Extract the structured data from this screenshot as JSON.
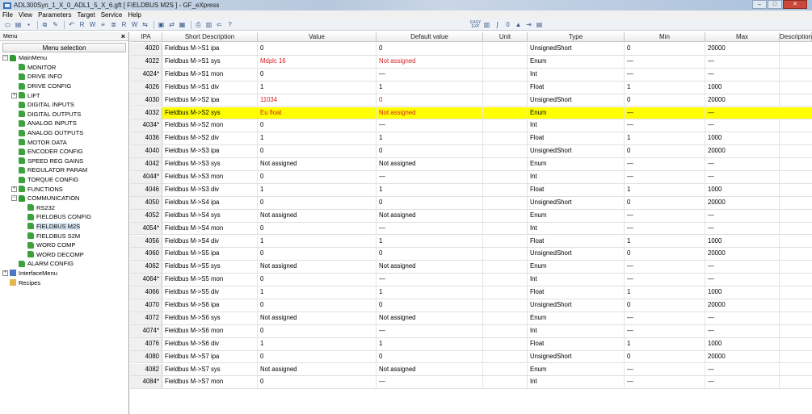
{
  "window": {
    "title": "ADL300Syn_1_X_0_ADL1_5_X_6.gft [ FIELDBUS M2S ] - GF_eXpress",
    "controls": [
      "–",
      "□",
      "✕"
    ]
  },
  "menubar": [
    "File",
    "View",
    "Parameters",
    "Target",
    "Service",
    "Help"
  ],
  "toolbar": {
    "group1": [
      "new-icon",
      "open-icon",
      "save-icon",
      "copy-icon",
      "edit-icon",
      "undo-icon",
      "r-icon",
      "w-icon",
      "w2-icon",
      "w3-icon",
      "r2-icon",
      "w4-icon",
      "compare-icon",
      "monitor-icon",
      "online-icon",
      "module-icon",
      "print-icon",
      "report-icon",
      "back-icon",
      "help-icon"
    ],
    "group2": [
      "easy-exp-icon",
      "bar-icon",
      "curve-icon",
      "zero-icon",
      "warning-icon",
      "expand-icon",
      "panel-icon"
    ],
    "group2_first_label": "EASY EXP"
  },
  "left_panel": {
    "title": "Menu",
    "close": "×",
    "menu_selection": "Menu selection",
    "tree": [
      {
        "label": "MainMenu",
        "level": 0,
        "exp": "−",
        "icon": "folder-open"
      },
      {
        "label": "MONITOR",
        "level": 1,
        "exp": "",
        "icon": "folder"
      },
      {
        "label": "DRIVE INFO",
        "level": 1,
        "exp": "",
        "icon": "folder"
      },
      {
        "label": "DRIVE CONFIG",
        "level": 1,
        "exp": "",
        "icon": "folder"
      },
      {
        "label": "LIFT",
        "level": 1,
        "exp": "+",
        "icon": "folder"
      },
      {
        "label": "DIGITAL INPUTS",
        "level": 1,
        "exp": "",
        "icon": "folder"
      },
      {
        "label": "DIGITAL OUTPUTS",
        "level": 1,
        "exp": "",
        "icon": "folder"
      },
      {
        "label": "ANALOG INPUTS",
        "level": 1,
        "exp": "",
        "icon": "folder"
      },
      {
        "label": "ANALOG OUTPUTS",
        "level": 1,
        "exp": "",
        "icon": "folder"
      },
      {
        "label": "MOTOR DATA",
        "level": 1,
        "exp": "",
        "icon": "folder"
      },
      {
        "label": "ENCODER CONFIG",
        "level": 1,
        "exp": "",
        "icon": "folder"
      },
      {
        "label": "SPEED REG GAINS",
        "level": 1,
        "exp": "",
        "icon": "folder"
      },
      {
        "label": "REGULATOR PARAM",
        "level": 1,
        "exp": "",
        "icon": "folder"
      },
      {
        "label": "TORQUE CONFIG",
        "level": 1,
        "exp": "",
        "icon": "folder"
      },
      {
        "label": "FUNCTIONS",
        "level": 1,
        "exp": "+",
        "icon": "folder"
      },
      {
        "label": "COMMUNICATION",
        "level": 1,
        "exp": "−",
        "icon": "folder-open"
      },
      {
        "label": "RS232",
        "level": 2,
        "exp": "",
        "icon": "folder"
      },
      {
        "label": "FIELDBUS CONFIG",
        "level": 2,
        "exp": "",
        "icon": "folder"
      },
      {
        "label": "FIELDBUS M2S",
        "level": 2,
        "exp": "",
        "icon": "folder",
        "selected": true
      },
      {
        "label": "FIELDBUS S2M",
        "level": 2,
        "exp": "",
        "icon": "folder"
      },
      {
        "label": "WORD COMP",
        "level": 2,
        "exp": "",
        "icon": "folder"
      },
      {
        "label": "WORD DECOMP",
        "level": 2,
        "exp": "",
        "icon": "folder"
      },
      {
        "label": "ALARM CONFIG",
        "level": 1,
        "exp": "",
        "icon": "folder"
      },
      {
        "label": "InterfaceMenu",
        "level": 0,
        "exp": "+",
        "icon": "iface"
      },
      {
        "label": "Recipes",
        "level": 0,
        "exp": "",
        "icon": "recipes"
      }
    ]
  },
  "grid": {
    "columns": [
      "IPA",
      "Short Description",
      "Value",
      "Default value",
      "Unit",
      "Type",
      "Min",
      "Max",
      "Description"
    ],
    "rows": [
      {
        "ipa": "4020",
        "desc": "Fieldbus M->S1 ipa",
        "value": "0",
        "default": "0",
        "unit": "",
        "type": "UnsignedShort",
        "min": "0",
        "max": "20000"
      },
      {
        "ipa": "4022",
        "desc": "Fieldbus M->S1 sys",
        "value": "Mdplc 16",
        "default": "Not assigned",
        "unit": "",
        "type": "Enum",
        "min": "—",
        "max": "—",
        "red": true
      },
      {
        "ipa": "4024*",
        "desc": "Fieldbus M->S1 mon",
        "value": "0",
        "default": "—",
        "unit": "",
        "type": "Int",
        "min": "—",
        "max": "—"
      },
      {
        "ipa": "4026",
        "desc": "Fieldbus M->S1 div",
        "value": "1",
        "default": "1",
        "unit": "",
        "type": "Float",
        "min": "1",
        "max": "1000"
      },
      {
        "ipa": "4030",
        "desc": "Fieldbus M->S2 ipa",
        "value": "11034",
        "default": "0",
        "unit": "",
        "type": "UnsignedShort",
        "min": "0",
        "max": "20000",
        "red": true
      },
      {
        "ipa": "4032",
        "desc": "Fieldbus M->S2 sys",
        "value": "Eu float",
        "default": "Not assigned",
        "unit": "",
        "type": "Enum",
        "min": "—",
        "max": "—",
        "red": true,
        "highlight": true
      },
      {
        "ipa": "4034*",
        "desc": "Fieldbus M->S2 mon",
        "value": "0",
        "default": "—",
        "unit": "",
        "type": "Int",
        "min": "—",
        "max": "—"
      },
      {
        "ipa": "4036",
        "desc": "Fieldbus M->S2 div",
        "value": "1",
        "default": "1",
        "unit": "",
        "type": "Float",
        "min": "1",
        "max": "1000"
      },
      {
        "ipa": "4040",
        "desc": "Fieldbus M->S3 ipa",
        "value": "0",
        "default": "0",
        "unit": "",
        "type": "UnsignedShort",
        "min": "0",
        "max": "20000"
      },
      {
        "ipa": "4042",
        "desc": "Fieldbus M->S3 sys",
        "value": "Not assigned",
        "default": "Not assigned",
        "unit": "",
        "type": "Enum",
        "min": "—",
        "max": "—"
      },
      {
        "ipa": "4044*",
        "desc": "Fieldbus M->S3 mon",
        "value": "0",
        "default": "—",
        "unit": "",
        "type": "Int",
        "min": "—",
        "max": "—"
      },
      {
        "ipa": "4046",
        "desc": "Fieldbus M->S3 div",
        "value": "1",
        "default": "1",
        "unit": "",
        "type": "Float",
        "min": "1",
        "max": "1000"
      },
      {
        "ipa": "4050",
        "desc": "Fieldbus M->S4 ipa",
        "value": "0",
        "default": "0",
        "unit": "",
        "type": "UnsignedShort",
        "min": "0",
        "max": "20000"
      },
      {
        "ipa": "4052",
        "desc": "Fieldbus M->S4 sys",
        "value": "Not assigned",
        "default": "Not assigned",
        "unit": "",
        "type": "Enum",
        "min": "—",
        "max": "—"
      },
      {
        "ipa": "4054*",
        "desc": "Fieldbus M->S4 mon",
        "value": "0",
        "default": "—",
        "unit": "",
        "type": "Int",
        "min": "—",
        "max": "—"
      },
      {
        "ipa": "4056",
        "desc": "Fieldbus M->S4 div",
        "value": "1",
        "default": "1",
        "unit": "",
        "type": "Float",
        "min": "1",
        "max": "1000"
      },
      {
        "ipa": "4060",
        "desc": "Fieldbus M->S5 ipa",
        "value": "0",
        "default": "0",
        "unit": "",
        "type": "UnsignedShort",
        "min": "0",
        "max": "20000"
      },
      {
        "ipa": "4062",
        "desc": "Fieldbus M->S5 sys",
        "value": "Not assigned",
        "default": "Not assigned",
        "unit": "",
        "type": "Enum",
        "min": "—",
        "max": "—"
      },
      {
        "ipa": "4064*",
        "desc": "Fieldbus M->S5 mon",
        "value": "0",
        "default": "—",
        "unit": "",
        "type": "Int",
        "min": "—",
        "max": "—"
      },
      {
        "ipa": "4066",
        "desc": "Fieldbus M->S5 div",
        "value": "1",
        "default": "1",
        "unit": "",
        "type": "Float",
        "min": "1",
        "max": "1000"
      },
      {
        "ipa": "4070",
        "desc": "Fieldbus M->S6 ipa",
        "value": "0",
        "default": "0",
        "unit": "",
        "type": "UnsignedShort",
        "min": "0",
        "max": "20000"
      },
      {
        "ipa": "4072",
        "desc": "Fieldbus M->S6 sys",
        "value": "Not assigned",
        "default": "Not assigned",
        "unit": "",
        "type": "Enum",
        "min": "—",
        "max": "—"
      },
      {
        "ipa": "4074*",
        "desc": "Fieldbus M->S6 mon",
        "value": "0",
        "default": "—",
        "unit": "",
        "type": "Int",
        "min": "—",
        "max": "—"
      },
      {
        "ipa": "4076",
        "desc": "Fieldbus M->S6 div",
        "value": "1",
        "default": "1",
        "unit": "",
        "type": "Float",
        "min": "1",
        "max": "1000"
      },
      {
        "ipa": "4080",
        "desc": "Fieldbus M->S7 ipa",
        "value": "0",
        "default": "0",
        "unit": "",
        "type": "UnsignedShort",
        "min": "0",
        "max": "20000"
      },
      {
        "ipa": "4082",
        "desc": "Fieldbus M->S7 sys",
        "value": "Not assigned",
        "default": "Not assigned",
        "unit": "",
        "type": "Enum",
        "min": "—",
        "max": "—"
      },
      {
        "ipa": "4084*",
        "desc": "Fieldbus M->S7 mon",
        "value": "0",
        "default": "—",
        "unit": "",
        "type": "Int",
        "min": "—",
        "max": "—"
      }
    ]
  },
  "colors": {
    "highlight_row": "#ffff00",
    "modified_value": "#d42020",
    "tree_folder": "#2f9a2f"
  }
}
